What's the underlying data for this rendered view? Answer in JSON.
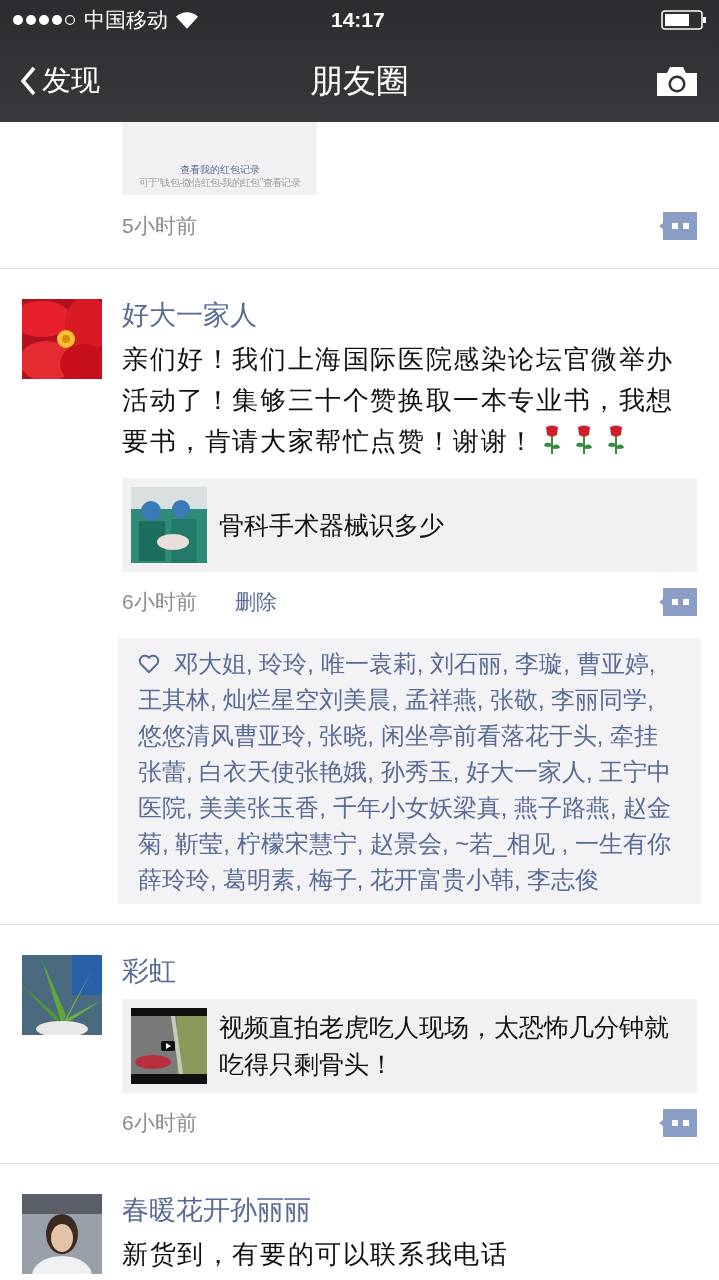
{
  "status_bar": {
    "carrier": "中国移动",
    "time": "14:17"
  },
  "nav": {
    "back": "发现",
    "title": "朋友圈"
  },
  "posts": [
    {
      "kind": "tail",
      "card": {
        "title": "查看我的红包记录",
        "subtitle": "可于“钱包-微信红包-我的红包”查看记录"
      },
      "time": "5小时前"
    },
    {
      "kind": "full",
      "author": "好大一家人",
      "avatar": {
        "kind": "picture"
      },
      "text": "亲们好！我们上海国际医院感染论坛官微举办活动了！集够三十个赞换取一本专业书，我想要书，肯请大家帮忙点赞！谢谢！",
      "emoji": [
        {
          "kind": "rose"
        },
        {
          "kind": "rose"
        },
        {
          "kind": "rose"
        }
      ],
      "link": {
        "thumb": {
          "kind": "picture"
        },
        "text": "骨科手术器械识多少"
      },
      "time": "6小时前",
      "delete": "删除",
      "likes": "邓大姐, 玲玲, 唯一袁莉, 刘石丽, 李璇, 曹亚婷, 王其林, 灿烂星空刘美晨, 孟祥燕, 张敬, 李丽同学, 悠悠清风曹亚玲, 张晓, 闲坐亭前看落花于头, 牵挂张蕾, 白衣天使张艳娥, 孙秀玉, 好大一家人, 王宁中医院, 美美张玉香, 千年小女妖梁真, 燕子路燕, 赵金菊, 靳莹, 柠檬宋慧宁, 赵景会, ~若_相见 , 一生有你薛玲玲, 葛明素, 梅子, 花开富贵小韩, 李志俊"
    },
    {
      "kind": "full",
      "author": "彩虹",
      "avatar": {
        "kind": "picture"
      },
      "link": {
        "thumb": {
          "kind": "picture"
        },
        "text": "视频直拍老虎吃人现场，太恐怖几分钟就吃得只剩骨头！"
      },
      "time": "6小时前"
    },
    {
      "kind": "head",
      "author": "春暖花开孙丽丽",
      "avatar": {
        "kind": "picture"
      },
      "text": "新货到，有要的可以联系我电话"
    }
  ]
}
